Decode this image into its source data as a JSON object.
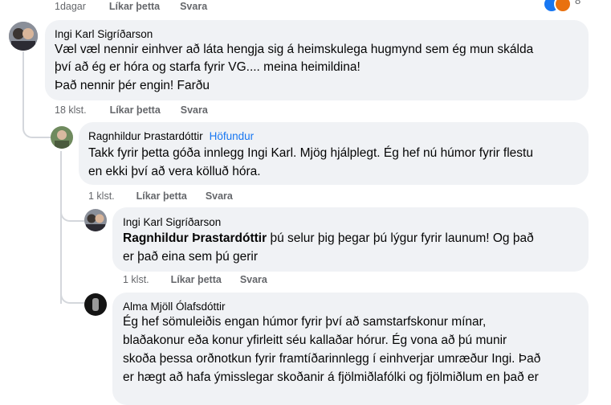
{
  "comments": [
    {
      "meta": {
        "time": "1dagar",
        "like": "Líkar þetta",
        "reply": "Svara"
      },
      "reaction_count": "8"
    },
    {
      "author": "Ingi Karl Sigríðarson",
      "lines": [
        "Væl væl nennir einhver að láta hengja sig á heimskulega hugmynd sem ég mun skálda",
        "því að ég er hóra og starfa fyrir VG.... meina heimildina!",
        "Það nennir þér engin! Farðu"
      ],
      "meta": {
        "time": "18 klst.",
        "like": "Líkar þetta",
        "reply": "Svara"
      }
    },
    {
      "author": "Ragnhildur Þrastardóttir",
      "tag": "Höfundur",
      "lines": [
        "Takk fyrir þetta góða innlegg Ingi Karl. Mjög hjálplegt. Ég hef nú húmor fyrir flestu",
        "en ekki því að vera kölluð hóra."
      ],
      "meta": {
        "time": "1 klst.",
        "like": "Líkar þetta",
        "reply": "Svara"
      }
    },
    {
      "author": "Ingi Karl Sigríðarson",
      "mention": "Ragnhildur Þrastardóttir",
      "lines": [
        " þú selur þig þegar þú lýgur fyrir launum! Og það",
        "er það eina sem þú gerir"
      ],
      "meta": {
        "time": "1 klst.",
        "like": "Líkar þetta",
        "reply": "Svara"
      }
    },
    {
      "author": "Alma Mjöll Ólafsdóttir",
      "lines": [
        "Ég hef sömuleiðis engan húmor fyrir því að samstarfskonur mínar,",
        "blaðakonur eða konur yfirleitt séu kallaðar hórur. Ég vona að þú munir",
        "skoða þessa orðnotkun fyrir framtíðarinnlegg í einhverjar umræður Ingi. Það",
        "er hægt að hafa ýmisslegar skoðanir á fjölmiðlafólki og fjölmiðlum en það er"
      ]
    }
  ],
  "colors": {
    "bubble": "#f0f2f5",
    "meta": "#65676b",
    "author_tag": "#1877f2",
    "thread_line": "#d4d7dc"
  }
}
